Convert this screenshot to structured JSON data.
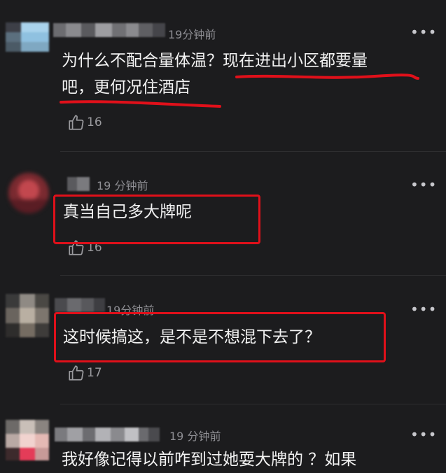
{
  "comments": [
    {
      "time": "19分钟前",
      "text_line1_a": "为什么不配合量体温？",
      "text_line1_b": "现在进出小区都要量",
      "text_line2": "吧，更何况住酒店",
      "likes": "16"
    },
    {
      "time": "19 分钟前",
      "text": "真当自己多大牌呢",
      "likes": "16"
    },
    {
      "time": "19分钟前",
      "text": "这时候搞这，是不是不想混下去了？",
      "likes": "17"
    },
    {
      "time": "19 分钟前",
      "text": "我好像记得以前咋到过她耍大牌的 ？如果"
    }
  ],
  "icons": {
    "more": "more-dots-icon",
    "like": "thumbs-up-icon"
  },
  "colors": {
    "background": "#1c1c1e",
    "annotation_red": "#e0101a",
    "secondary_text": "#8e8e93"
  }
}
